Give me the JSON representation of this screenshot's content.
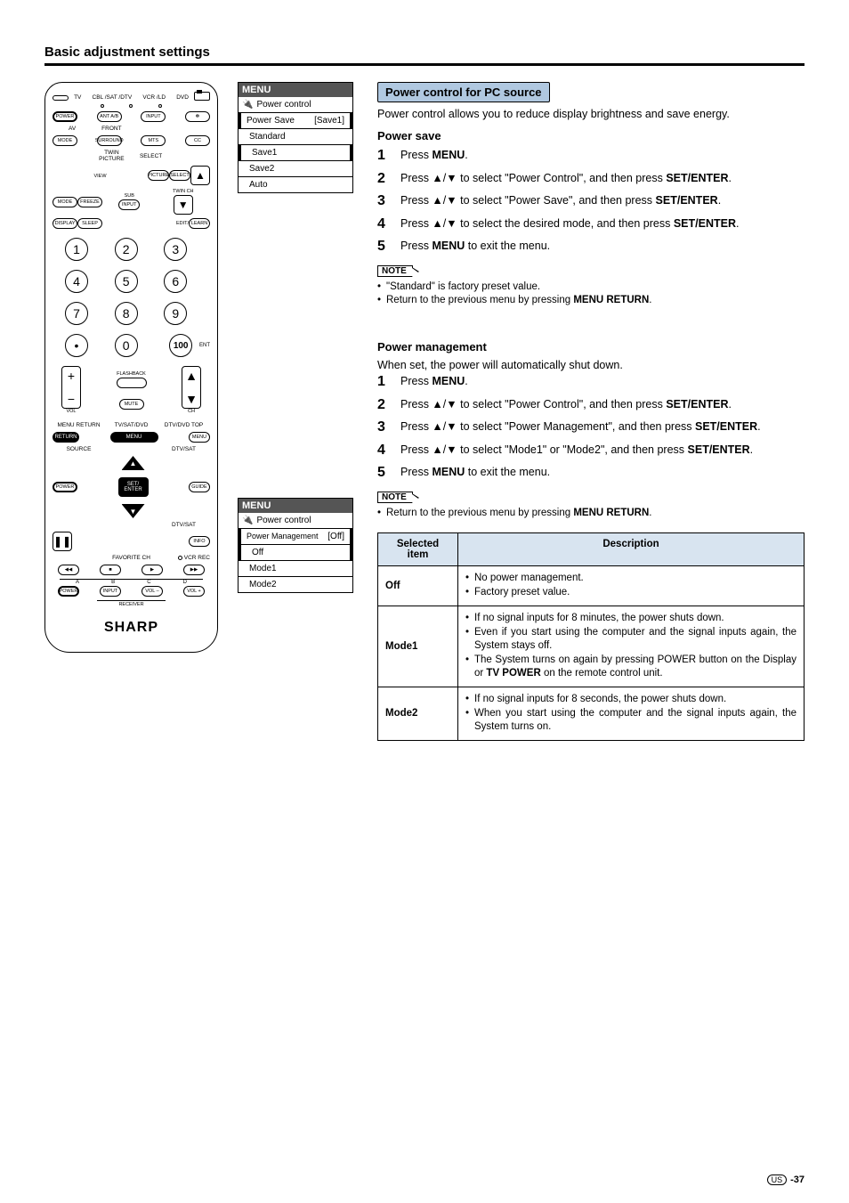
{
  "section_title": "Basic adjustment settings",
  "remote": {
    "top_labels": [
      "TV",
      "CBL /SAT /DTV",
      "VCR /LD",
      "DVD"
    ],
    "row1": {
      "b1": "POWER",
      "b2": "ANT A/B",
      "b3": "INPUT",
      "b4": "✻"
    },
    "row2_labels": {
      "a": "AV",
      "b": "FRONT"
    },
    "row2": {
      "b1": "MODE",
      "b2": "SURROUND",
      "b3": "MTS",
      "b4": "CC"
    },
    "row3_labels": {
      "a": "VIEW",
      "b": "TWIN PICTURE",
      "c": "SELECT"
    },
    "row3": {
      "b1": "MODE",
      "b2": "FREEZE",
      "b3_label": "SUB",
      "b3": "INPUT",
      "b4_label": "TWIN CH",
      "b4": "▼",
      "b5": "▲"
    },
    "row4": {
      "b1": "DISPLAY",
      "b2": "SLEEP",
      "b3": "EDIT/",
      "b4": "LEARN"
    },
    "numpad": [
      "1",
      "2",
      "3",
      "4",
      "5",
      "6",
      "7",
      "8",
      "9",
      "•",
      "0",
      "100"
    ],
    "ent": "ENT",
    "vol": "VOL",
    "ch": "CH",
    "mute": "MUTE",
    "flashback": "FLASHBACK",
    "menu_labels": {
      "a": "MENU RETURN",
      "b": "TV/SAT/DVD",
      "c": "DTV/DVD TOP"
    },
    "menu_btns": {
      "a": "RETURN",
      "b": "MENU",
      "c": "MENU"
    },
    "row_src": {
      "a": "SOURCE",
      "b": "DTV/SAT"
    },
    "row_pg": {
      "a": "POWER",
      "b": "GUIDE"
    },
    "nav_center": "SET/\nENTER",
    "row_info": {
      "a": "DTV/SAT",
      "b": "INFO"
    },
    "pause": "❚❚",
    "fav": "FAVORITE CH",
    "vcr": "VCR REC",
    "transport": [
      "◀◀",
      "■",
      "▶",
      "▶▶"
    ],
    "abcd": [
      "A",
      "B",
      "C",
      "D"
    ],
    "receiver_row": {
      "a": "POWER",
      "b": "INPUT",
      "c": "VOL –",
      "d": "VOL +"
    },
    "receiver": "RECEIVER",
    "logo": "SHARP"
  },
  "menu1": {
    "title": "MENU",
    "sub": "Power control",
    "row_label": "Power Save",
    "row_val": "[Save1]",
    "opts": [
      "Standard",
      "Save1",
      "Save2",
      "Auto"
    ],
    "highlight": "Save1"
  },
  "menu2": {
    "title": "MENU",
    "sub": "Power control",
    "row_label": "Power Management",
    "row_val": "[Off]",
    "opts": [
      "Off",
      "Mode1",
      "Mode2"
    ],
    "highlight": "Off"
  },
  "feature_title": "Power control for PC source",
  "intro": "Power control allows you to reduce display brightness and save energy.",
  "ps": {
    "heading": "Power save",
    "steps": [
      {
        "n": "1",
        "pre": "Press ",
        "b": "MENU",
        "post": "."
      },
      {
        "n": "2",
        "pre": "Press ▲/▼ to select \"Power Control\", and then press ",
        "b": "SET/ENTER",
        "post": "."
      },
      {
        "n": "3",
        "pre": "Press ▲/▼ to select \"Power Save\", and then press ",
        "b": "SET/ENTER",
        "post": "."
      },
      {
        "n": "4",
        "pre": "Press ▲/▼ to select the desired mode, and then press ",
        "b": "SET/ENTER",
        "post": "."
      },
      {
        "n": "5",
        "pre": "Press ",
        "b": "MENU",
        "post": " to exit the menu."
      }
    ],
    "note_label": "NOTE",
    "notes": [
      "\"Standard\" is factory preset value.",
      "Return to the previous menu by pressing MENU RETURN."
    ]
  },
  "pm": {
    "heading": "Power management",
    "intro": "When set, the power will automatically shut down.",
    "steps": [
      {
        "n": "1",
        "pre": "Press ",
        "b": "MENU",
        "post": "."
      },
      {
        "n": "2",
        "pre": "Press ▲/▼ to select \"Power Control\", and then press ",
        "b": "SET/ENTER",
        "post": "."
      },
      {
        "n": "3",
        "pre": "Press ▲/▼ to select \"Power Management\", and then press ",
        "b": "SET/ENTER",
        "post": "."
      },
      {
        "n": "4",
        "pre": "Press ▲/▼ to select \"Mode1\" or \"Mode2\", and then press ",
        "b": "SET/ENTER",
        "post": "."
      },
      {
        "n": "5",
        "pre": "Press ",
        "b": "MENU",
        "post": " to exit the menu."
      }
    ],
    "note_label": "NOTE",
    "notes": [
      "Return to the previous menu by pressing MENU RETURN."
    ]
  },
  "table": {
    "h1": "Selected item",
    "h2": "Description",
    "rows": [
      {
        "item": "Off",
        "desc": [
          "No power management.",
          "Factory preset value."
        ]
      },
      {
        "item": "Mode1",
        "desc": [
          "If no signal inputs for 8 minutes, the power shuts down.",
          "Even if you start using the computer and the signal inputs again, the System stays off.",
          "The System turns on again by pressing POWER button on the Display or TV POWER on the remote control unit."
        ]
      },
      {
        "item": "Mode2",
        "desc": [
          "If no signal inputs for 8 seconds, the power shuts down.",
          "When you start using the computer and the signal inputs again, the System turns on."
        ]
      }
    ]
  },
  "page_num": "-37",
  "region": "US"
}
